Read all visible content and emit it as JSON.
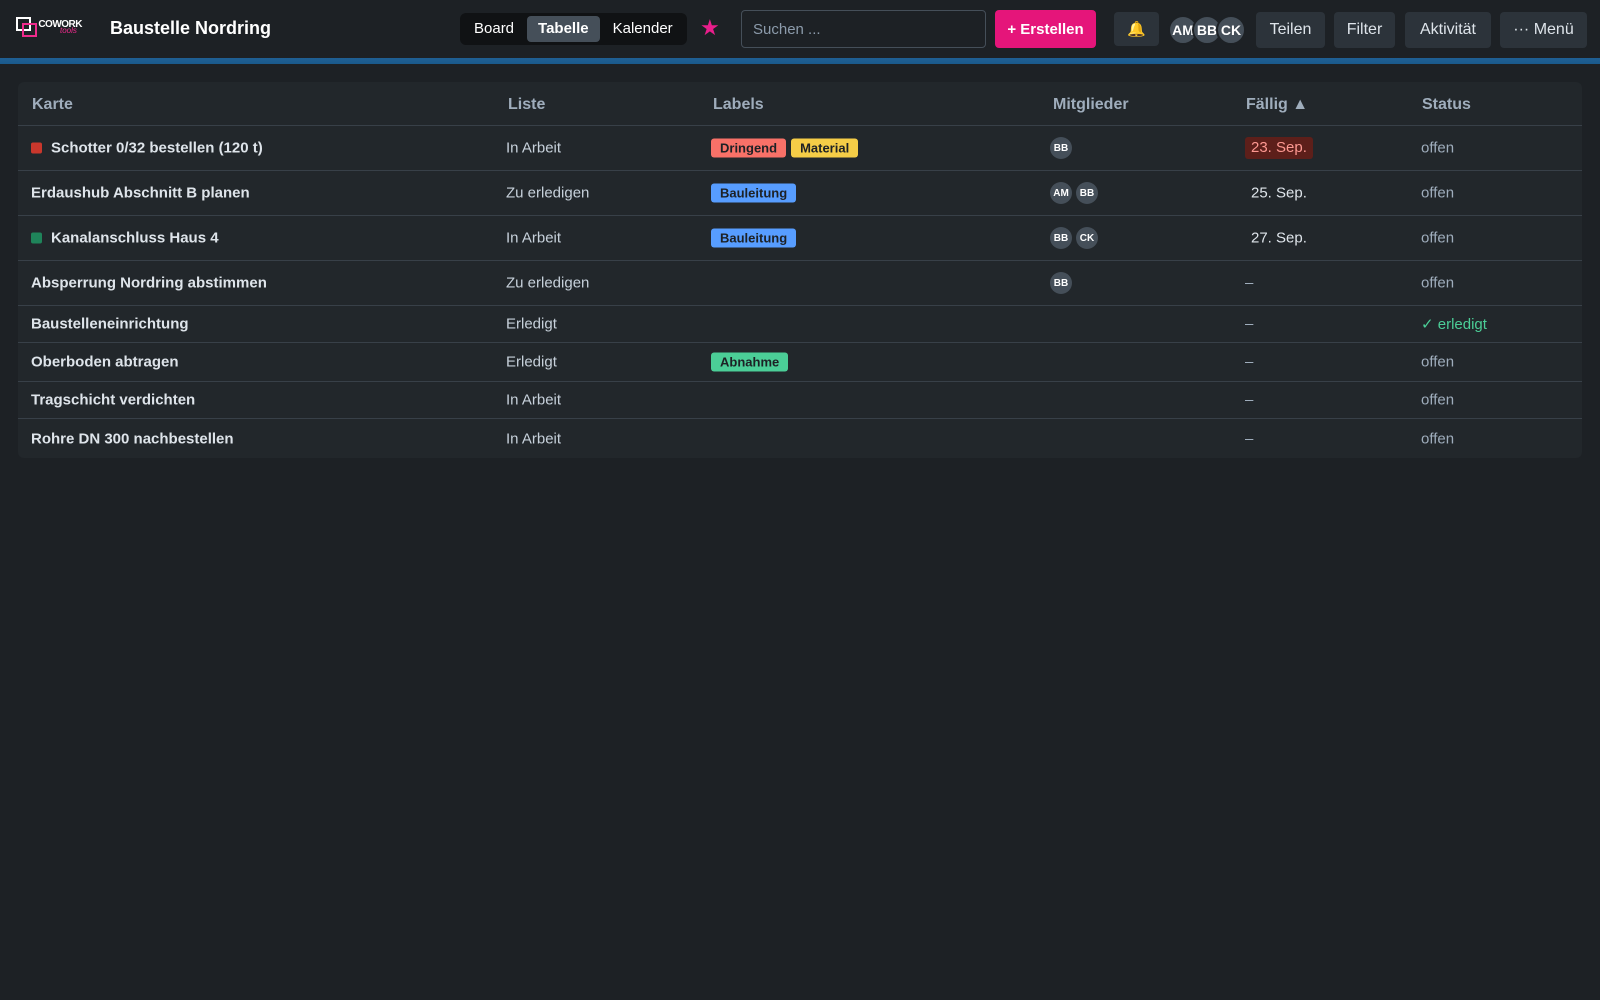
{
  "app": {
    "logo_text": "COWORK",
    "logo_sub": "tools",
    "board_title": "Baustelle Nordring"
  },
  "views": [
    {
      "label": "Board",
      "active": false
    },
    {
      "label": "Tabelle",
      "active": true
    },
    {
      "label": "Kalender",
      "active": false
    }
  ],
  "header": {
    "star_icon": "★",
    "search_placeholder": "Suchen ...",
    "create_label": "+ Erstellen",
    "bell_icon": "🔔",
    "avatars": [
      "AM",
      "BB",
      "CK"
    ],
    "share_label": "Teilen",
    "filter_label": "Filter",
    "activity_label": "Aktivität",
    "menu_label": "··· Menü"
  },
  "colors": {
    "accent_strip": "#1f5f94",
    "create": "#e5157a",
    "label_red": "#f87168",
    "label_yellow": "#f5cd47",
    "label_blue": "#579dff",
    "label_green": "#4bce97",
    "dot_red": "#c9372c",
    "dot_green": "#1f845a"
  },
  "table": {
    "columns": {
      "card": "Karte",
      "list": "Liste",
      "labels": "Labels",
      "members": "Mitglieder",
      "due": "Fällig ▲",
      "status": "Status"
    },
    "rows": [
      {
        "title": "Schotter 0/32 bestellen (120 t)",
        "dot": "red",
        "list": "In Arbeit",
        "labels": [
          {
            "text": "Dringend",
            "color": "red"
          },
          {
            "text": "Material",
            "color": "yellow"
          }
        ],
        "members": [
          "BB"
        ],
        "due": "23. Sep.",
        "due_state": "overdue",
        "status": "offen",
        "status_state": "open"
      },
      {
        "title": "Erdaushub Abschnitt B planen",
        "dot": null,
        "list": "Zu erledigen",
        "labels": [
          {
            "text": "Bauleitung",
            "color": "blue"
          }
        ],
        "members": [
          "AM",
          "BB"
        ],
        "due": "25. Sep.",
        "due_state": "normal",
        "status": "offen",
        "status_state": "open"
      },
      {
        "title": "Kanalanschluss Haus 4",
        "dot": "green",
        "list": "In Arbeit",
        "labels": [
          {
            "text": "Bauleitung",
            "color": "blue"
          }
        ],
        "members": [
          "BB",
          "CK"
        ],
        "due": "27. Sep.",
        "due_state": "normal",
        "status": "offen",
        "status_state": "open"
      },
      {
        "title": "Absperrung Nordring abstimmen",
        "dot": null,
        "list": "Zu erledigen",
        "labels": [],
        "members": [
          "BB"
        ],
        "due": "–",
        "due_state": "none",
        "status": "offen",
        "status_state": "open"
      },
      {
        "title": "Baustelleneinrichtung",
        "dot": null,
        "list": "Erledigt",
        "labels": [],
        "members": [],
        "due": "–",
        "due_state": "none",
        "status": "✓ erledigt",
        "status_state": "done"
      },
      {
        "title": "Oberboden abtragen",
        "dot": null,
        "list": "Erledigt",
        "labels": [
          {
            "text": "Abnahme",
            "color": "green"
          }
        ],
        "members": [],
        "due": "–",
        "due_state": "none",
        "status": "offen",
        "status_state": "open"
      },
      {
        "title": "Tragschicht verdichten",
        "dot": null,
        "list": "In Arbeit",
        "labels": [],
        "members": [],
        "due": "–",
        "due_state": "none",
        "status": "offen",
        "status_state": "open"
      },
      {
        "title": "Rohre DN 300 nachbestellen",
        "dot": null,
        "list": "In Arbeit",
        "labels": [],
        "members": [],
        "due": "–",
        "due_state": "none",
        "status": "offen",
        "status_state": "open"
      }
    ]
  }
}
